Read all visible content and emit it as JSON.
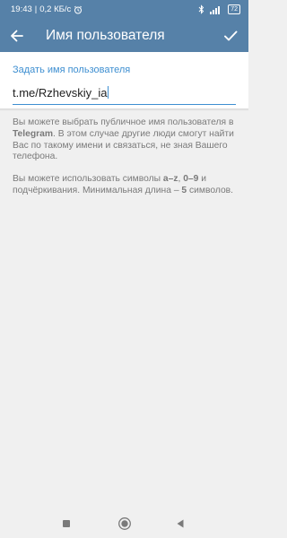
{
  "status_bar": {
    "time": "19:43",
    "network_speed": "0,2 КБ/с",
    "battery": "72"
  },
  "app_bar": {
    "title": "Имя пользователя"
  },
  "username_section": {
    "label": "Задать имя пользователя",
    "value": "t.me/Rzhevskiy_ia"
  },
  "info": {
    "p1_before": "Вы можете выбрать публичное имя пользователя в ",
    "p1_bold": "Telegram",
    "p1_after": ". В этом случае другие люди смогут найти Вас по такому имени и связаться, не зная Вашего телефона.",
    "p2_before": "Вы можете использовать символы ",
    "p2_bold1": "a–z",
    "p2_sep": ", ",
    "p2_bold2": "0–9",
    "p2_after": " и подчёркивания. Минимальная длина – ",
    "p2_bold3": "5",
    "p2_end": " символов."
  },
  "icons": {
    "back": "arrow-left-icon",
    "confirm": "checkmark-icon",
    "alarm": "alarm-clock-icon",
    "bluetooth": "bluetooth-icon",
    "signal": "signal-icon",
    "nav_recents": "square-icon",
    "nav_home": "circle-icon",
    "nav_back": "triangle-back-icon"
  },
  "colors": {
    "header": "#5681a8",
    "accent": "#3e8fd1",
    "background": "#f0f0f0"
  }
}
